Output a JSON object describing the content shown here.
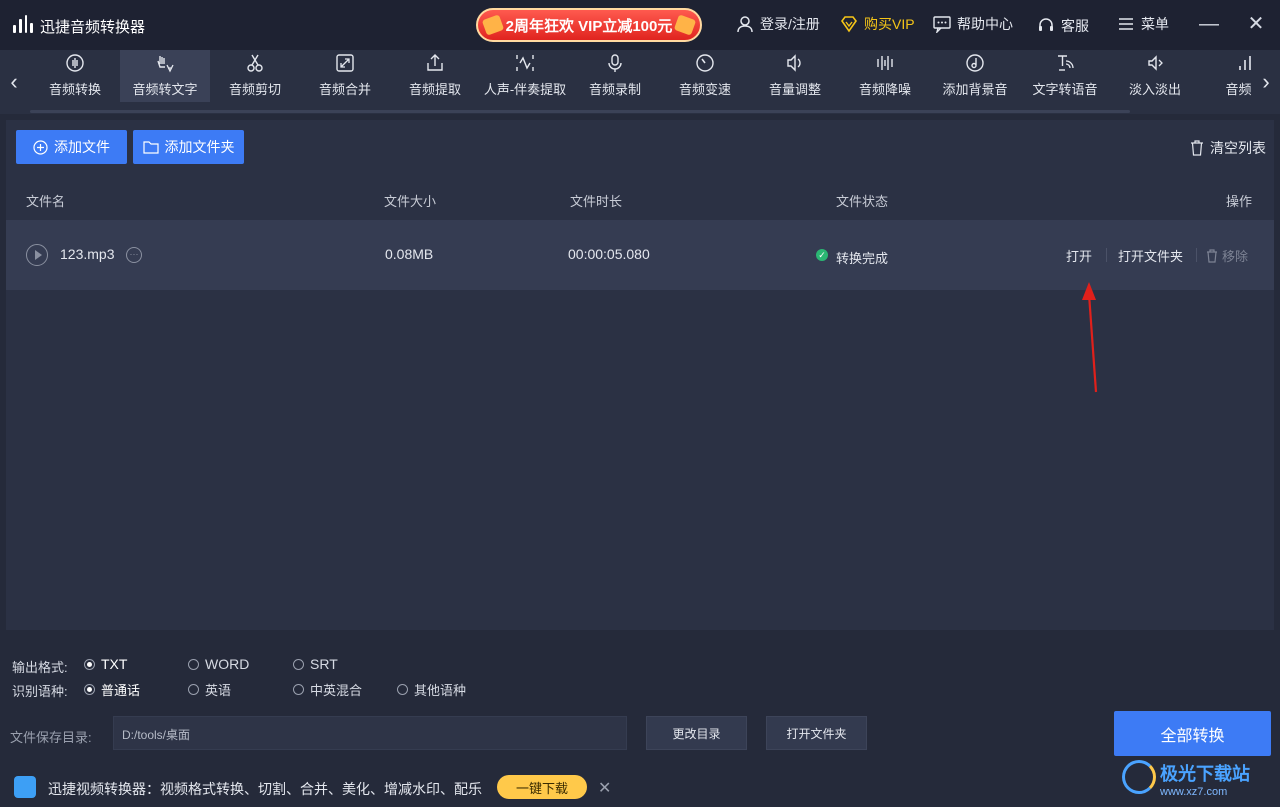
{
  "app": {
    "title": "迅捷音频转换器"
  },
  "promo": {
    "text": "2周年狂欢 VIP立减100元"
  },
  "titlebar": {
    "login": "登录/注册",
    "vip": "购买VIP",
    "help": "帮助中心",
    "service": "客服",
    "menu": "菜单"
  },
  "tools": [
    {
      "label": "音频转换",
      "icon": "waveform-circle-icon"
    },
    {
      "label": "音频转文字",
      "icon": "hand-text-icon"
    },
    {
      "label": "音频剪切",
      "icon": "scissors-icon"
    },
    {
      "label": "音频合并",
      "icon": "merge-icon"
    },
    {
      "label": "音频提取",
      "icon": "upload-icon"
    },
    {
      "label": "人声-伴奏提取",
      "icon": "voice-wave-icon"
    },
    {
      "label": "音频录制",
      "icon": "microphone-icon"
    },
    {
      "label": "音频变速",
      "icon": "speedometer-icon"
    },
    {
      "label": "音量调整",
      "icon": "speaker-icon"
    },
    {
      "label": "音频降噪",
      "icon": "bars-icon"
    },
    {
      "label": "添加背景音",
      "icon": "music-disc-icon"
    },
    {
      "label": "文字转语音",
      "icon": "text-voice-icon"
    },
    {
      "label": "淡入淡出",
      "icon": "fade-icon"
    },
    {
      "label": "音频频",
      "icon": "chart-bars-icon"
    }
  ],
  "actions": {
    "add_file": "添加文件",
    "add_folder": "添加文件夹",
    "clear_list": "清空列表"
  },
  "table": {
    "headers": {
      "name": "文件名",
      "size": "文件大小",
      "duration": "文件时长",
      "status": "文件状态",
      "ops": "操作"
    },
    "rows": [
      {
        "name": "123.mp3",
        "size": "0.08MB",
        "duration": "00:00:05.080",
        "status": "转换完成",
        "open": "打开",
        "open_folder": "打开文件夹",
        "remove": "移除"
      }
    ]
  },
  "settings": {
    "format_label": "输出格式:",
    "formats": [
      "TXT",
      "WORD",
      "SRT"
    ],
    "format_selected": "TXT",
    "lang_label": "识别语种:",
    "langs": [
      "普通话",
      "英语",
      "中英混合",
      "其他语种"
    ],
    "lang_selected": "普通话",
    "dir_label": "文件保存目录:",
    "dir_value": "D:/tools/桌面",
    "change_dir": "更改目录",
    "open_folder": "打开文件夹",
    "convert_all": "全部转换"
  },
  "ad": {
    "text": "迅捷视频转换器：视频格式转换、切割、合并、美化、增减水印、配乐",
    "button": "一键下载"
  },
  "watermark": {
    "main": "极光下载站",
    "sub": "www.xz7.com"
  },
  "colors": {
    "accent": "#3d7bf5",
    "success": "#2bb673",
    "vip": "#f5c518",
    "annotation": "#e0201b"
  }
}
